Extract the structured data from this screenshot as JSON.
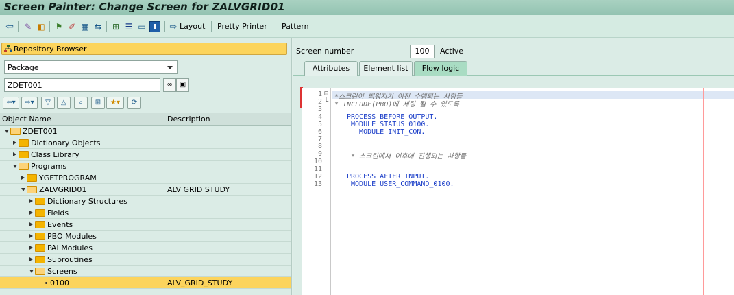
{
  "window": {
    "title": "Screen Painter: Change Screen for ZALVGRID01"
  },
  "toolbar": {
    "layout_label": "Layout",
    "pretty_printer_label": "Pretty Printer",
    "pattern_label": "Pattern"
  },
  "repository": {
    "header": "Repository Browser",
    "object_type": "Package",
    "package_value": "ZDET001",
    "columns": {
      "name": "Object Name",
      "description": "Description"
    },
    "tree": [
      {
        "label": "ZDET001",
        "desc": "",
        "expanded": true
      },
      {
        "label": "Dictionary Objects",
        "desc": ""
      },
      {
        "label": "Class Library",
        "desc": ""
      },
      {
        "label": "Programs",
        "desc": "",
        "expanded": true
      },
      {
        "label": "YGFTPROGRAM",
        "desc": ""
      },
      {
        "label": "ZALVGRID01",
        "desc": "ALV GRID STUDY",
        "expanded": true
      },
      {
        "label": "Dictionary Structures",
        "desc": ""
      },
      {
        "label": "Fields",
        "desc": ""
      },
      {
        "label": "Events",
        "desc": ""
      },
      {
        "label": "PBO Modules",
        "desc": ""
      },
      {
        "label": "PAI Modules",
        "desc": ""
      },
      {
        "label": "Subroutines",
        "desc": ""
      },
      {
        "label": "Screens",
        "desc": "",
        "expanded": true
      },
      {
        "label": "0100",
        "desc": "ALV_GRID_STUDY",
        "selected": true
      }
    ]
  },
  "screen": {
    "number_label": "Screen number",
    "number": "100",
    "status": "Active",
    "tabs": [
      "Attributes",
      "Element list",
      "Flow logic"
    ],
    "active_tab": "Flow logic"
  },
  "editor": {
    "lines": [
      {
        "n": "1",
        "text": "*스크린이 띄워지기 이전 수행되는 사항들",
        "kind": "comment"
      },
      {
        "n": "2",
        "text": "* INCLUDE(PBO)에 세팅 될 수 있도록",
        "kind": "comment"
      },
      {
        "n": "3",
        "text": "",
        "kind": "code"
      },
      {
        "n": "4",
        "text": "PROCESS BEFORE OUTPUT.",
        "kind": "code"
      },
      {
        "n": "5",
        "text": " MODULE STATUS_0100.",
        "kind": "code"
      },
      {
        "n": "6",
        "text": "   MODULE INIT_CON.",
        "kind": "code"
      },
      {
        "n": "7",
        "text": "",
        "kind": "code"
      },
      {
        "n": "8",
        "text": "",
        "kind": "code"
      },
      {
        "n": "9",
        "text": " * 스크린에서 이후에 진행되는 사항들",
        "kind": "comment"
      },
      {
        "n": "10",
        "text": "",
        "kind": "code"
      },
      {
        "n": "11",
        "text": "",
        "kind": "code"
      },
      {
        "n": "12",
        "text": "PROCESS AFTER INPUT.",
        "kind": "code"
      },
      {
        "n": "13",
        "text": " MODULE USER_COMMAND_0100.",
        "kind": "code"
      }
    ]
  },
  "colors": {
    "accent": "#fcd45c",
    "background": "#dbece6",
    "code": "#1b3ec8",
    "comment": "#6d6d6d"
  }
}
